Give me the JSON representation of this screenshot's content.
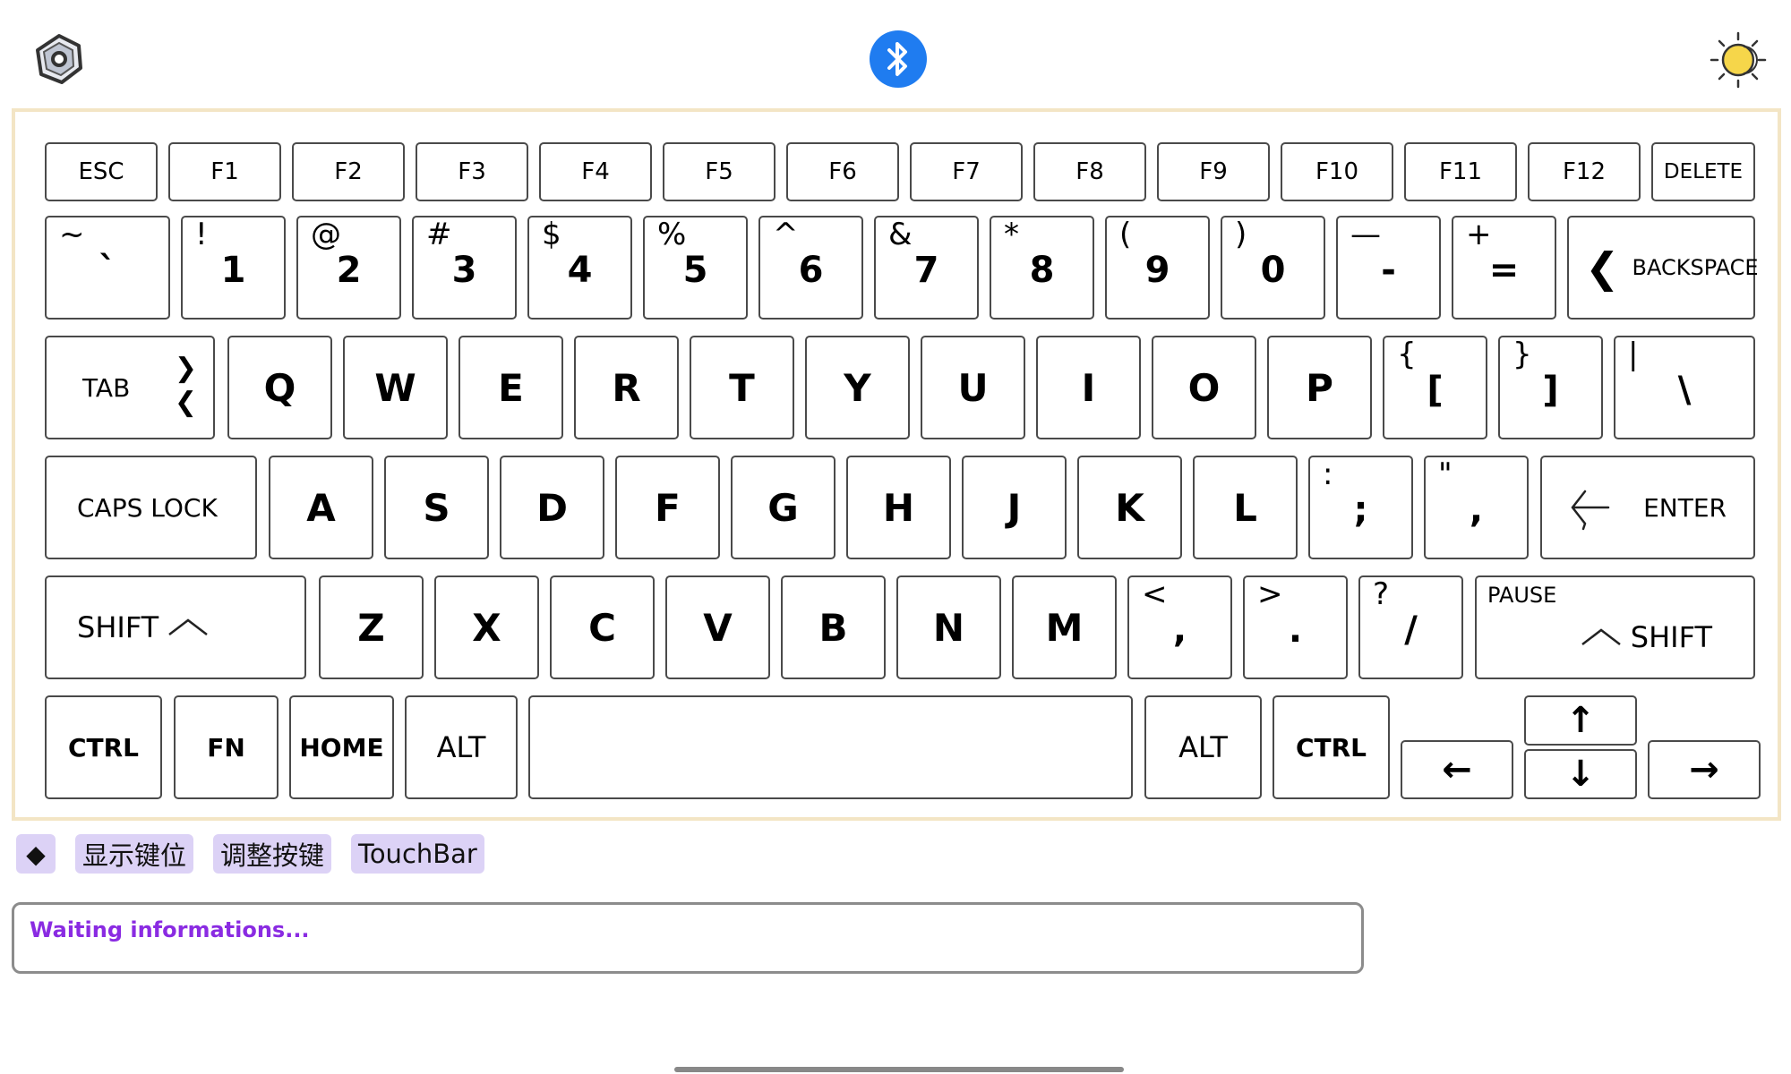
{
  "colors": {
    "accent_frame": "#f3e5c5",
    "chip_bg": "#dcd2f6",
    "status_text": "#8a2be2",
    "bluetooth": "#1f7cf0"
  },
  "toolbar": {
    "settings_icon": "hexagon-nut-icon",
    "bluetooth_icon": "bluetooth-icon",
    "theme_icon": "sun-moon-icon"
  },
  "keyboard": {
    "fn_row": [
      "ESC",
      "F1",
      "F2",
      "F3",
      "F4",
      "F5",
      "F6",
      "F7",
      "F8",
      "F9",
      "F10",
      "F11",
      "F12",
      "DELETE"
    ],
    "num_row": [
      {
        "up": "~",
        "lo": "`"
      },
      {
        "up": "!",
        "lo": "1"
      },
      {
        "up": "@",
        "lo": "2"
      },
      {
        "up": "#",
        "lo": "3"
      },
      {
        "up": "$",
        "lo": "4"
      },
      {
        "up": "%",
        "lo": "5"
      },
      {
        "up": "^",
        "lo": "6"
      },
      {
        "up": "&",
        "lo": "7"
      },
      {
        "up": "*",
        "lo": "8"
      },
      {
        "up": "(",
        "lo": "9"
      },
      {
        "up": ")",
        "lo": "0"
      },
      {
        "up": "—",
        "lo": "-"
      },
      {
        "up": "+",
        "lo": "="
      }
    ],
    "backspace": "BACKSPACE",
    "tab": "TAB",
    "q_row": [
      "Q",
      "W",
      "E",
      "R",
      "T",
      "Y",
      "U",
      "I",
      "O",
      "P"
    ],
    "q_row_sym": [
      {
        "up": "{",
        "lo": "["
      },
      {
        "up": "}",
        "lo": "]"
      },
      {
        "up": "|",
        "lo": "\\"
      }
    ],
    "caps": "CAPS LOCK",
    "a_row": [
      "A",
      "S",
      "D",
      "F",
      "G",
      "H",
      "J",
      "K",
      "L"
    ],
    "a_row_sym": [
      {
        "up": ":",
        "lo": ";"
      },
      {
        "up": "\"",
        "lo": ","
      }
    ],
    "enter": "ENTER",
    "shift_left": "SHIFT",
    "z_row": [
      "Z",
      "X",
      "C",
      "V",
      "B",
      "N",
      "M"
    ],
    "z_row_sym": [
      {
        "up": "<",
        "lo": ","
      },
      {
        "up": ">",
        "lo": "."
      },
      {
        "up": "?",
        "lo": "/"
      }
    ],
    "pause": "PAUSE",
    "shift_right": "SHIFT",
    "bottom": {
      "ctrl_l": "CTRL",
      "fn": "FN",
      "home": "HOME",
      "alt_l": "ALT",
      "alt_r": "ALT",
      "ctrl_r": "CTRL"
    },
    "arrows": {
      "up": "↑",
      "down": "↓",
      "left": "←",
      "right": "→"
    }
  },
  "chips": {
    "diamond": "◆",
    "show_keys": "显示键位",
    "adjust_keys": "调整按键",
    "touchbar": "TouchBar"
  },
  "status": {
    "text": "Waiting informations..."
  }
}
